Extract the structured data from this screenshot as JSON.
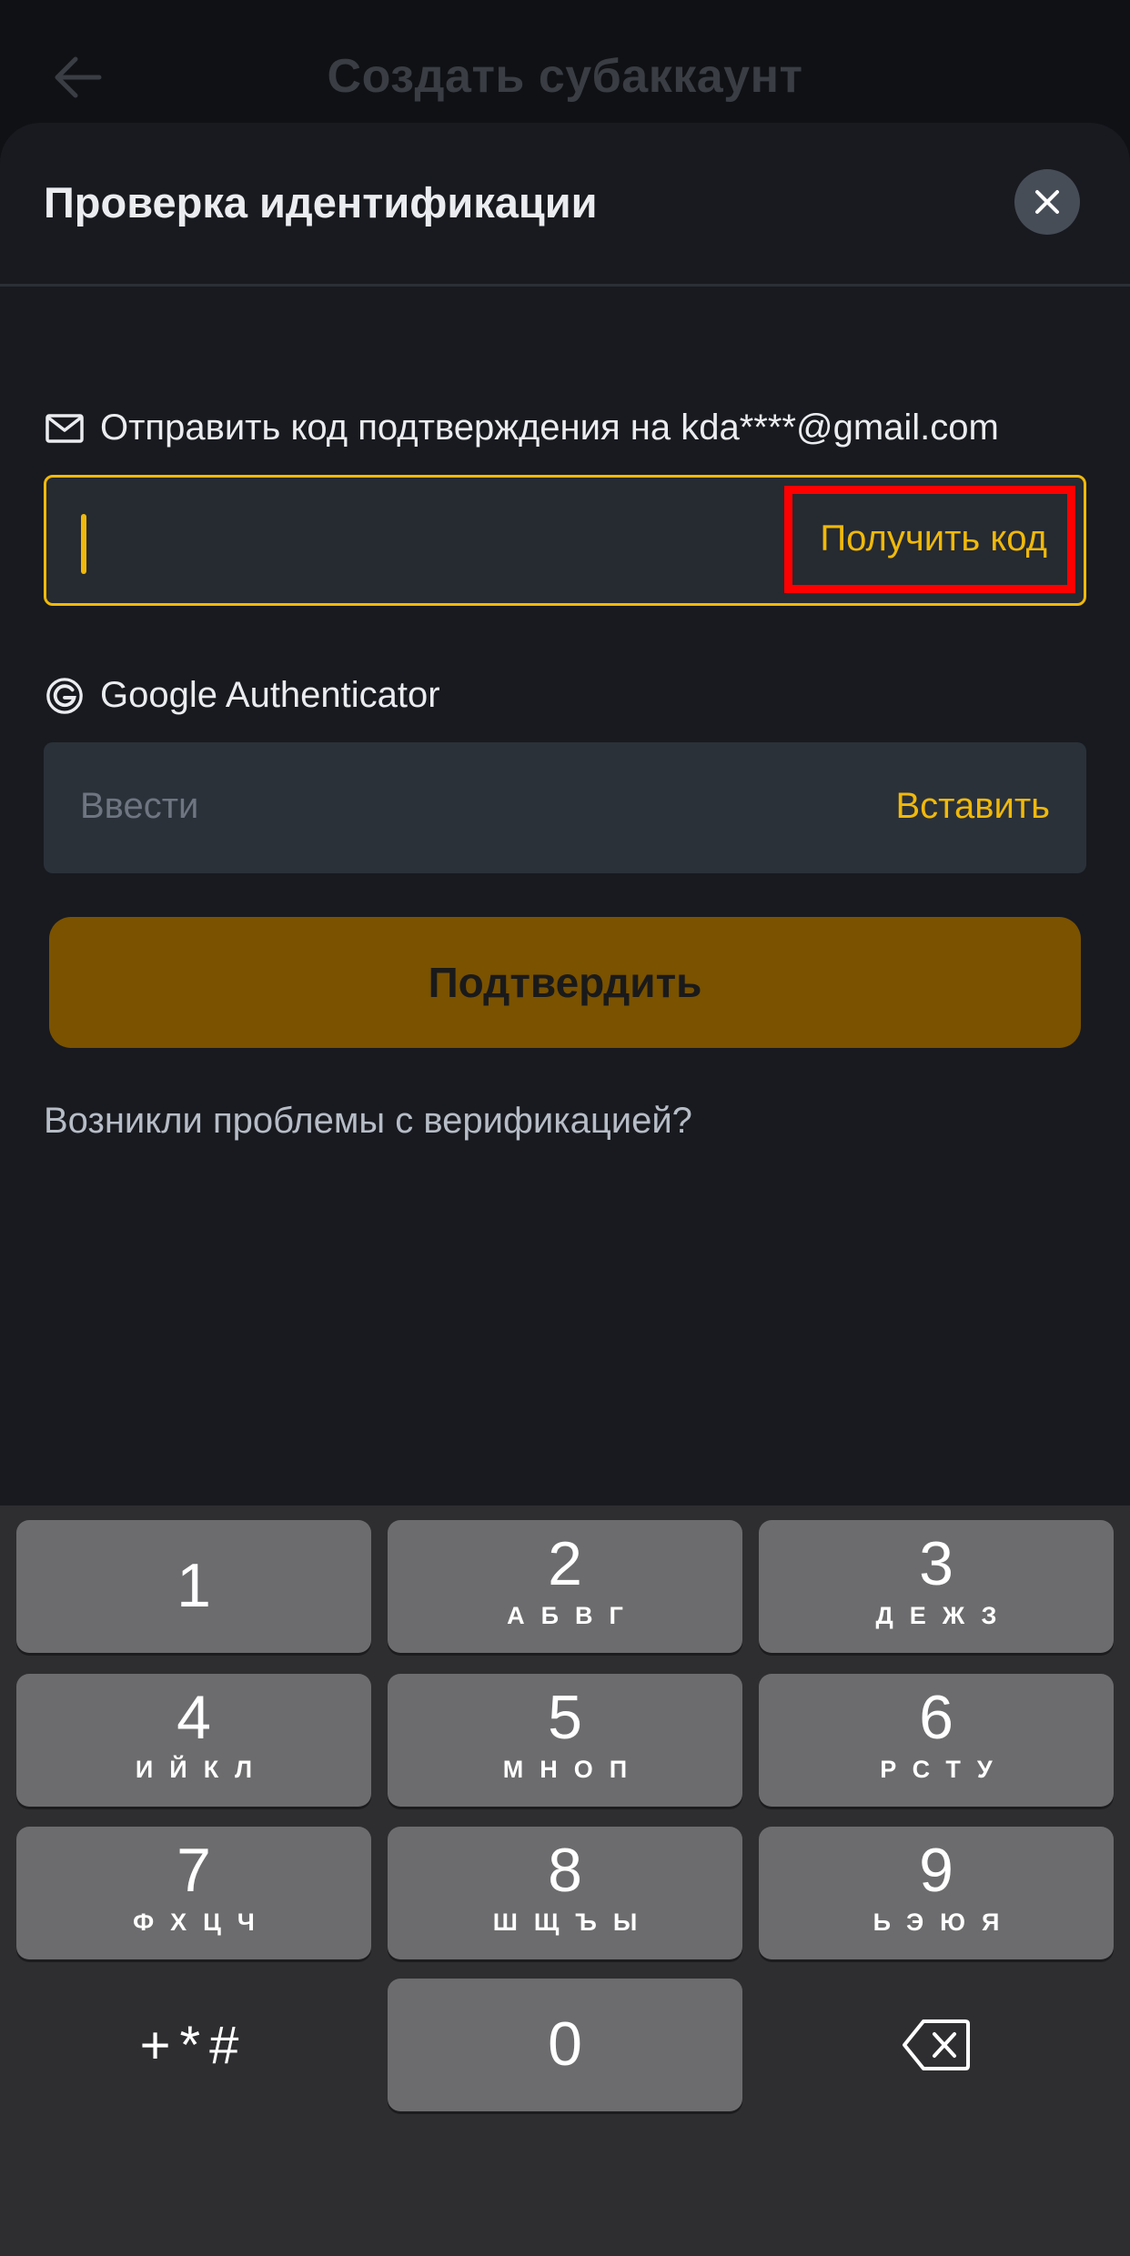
{
  "background": {
    "title": "Создать субаккаунт"
  },
  "sheet": {
    "title": "Проверка идентификации",
    "email": {
      "label": "Отправить код подтверждения на kda****@gmail.com",
      "action": "Получить код"
    },
    "authenticator": {
      "label": "Google Authenticator",
      "placeholder": "Ввести",
      "action": "Вставить"
    },
    "confirm_button": "Подтвердить",
    "problem_link": "Возникли проблемы с верификацией?"
  },
  "keyboard": {
    "keys": [
      {
        "num": "1",
        "letters": ""
      },
      {
        "num": "2",
        "letters": "АБВГ"
      },
      {
        "num": "3",
        "letters": "ДЕЖЗ"
      },
      {
        "num": "4",
        "letters": "ИЙКЛ"
      },
      {
        "num": "5",
        "letters": "МНОП"
      },
      {
        "num": "6",
        "letters": "РСТУ"
      },
      {
        "num": "7",
        "letters": "ФХЦЧ"
      },
      {
        "num": "8",
        "letters": "ШЩЪЫ"
      },
      {
        "num": "9",
        "letters": "ЬЭЮЯ"
      },
      {
        "num": "0",
        "letters": ""
      }
    ],
    "symbols": "+*#"
  },
  "colors": {
    "accent": "#f0b90b",
    "highlight": "#ff0000",
    "confirm_bg": "#7a5200"
  }
}
